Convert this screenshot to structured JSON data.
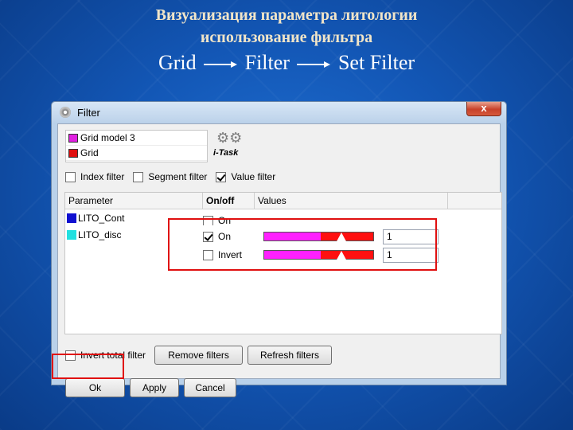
{
  "slide": {
    "title_line1": "Визуализация параметра литологии",
    "title_line2": "использование фильтра",
    "path": [
      "Grid",
      "Filter",
      "Set Filter"
    ]
  },
  "window": {
    "title": "Filter",
    "close_label": "x",
    "grid_list": [
      {
        "label": "Grid model 3",
        "color": "#e020e0"
      },
      {
        "label": "Grid",
        "color": "#e01010"
      }
    ],
    "itask_label": "i-Task",
    "filters": [
      {
        "label": "Index filter",
        "checked": false
      },
      {
        "label": "Segment filter",
        "checked": false
      },
      {
        "label": "Value filter",
        "checked": true
      }
    ],
    "table": {
      "headers": [
        "Parameter",
        "On/off",
        "Values"
      ],
      "parameters": [
        {
          "name": "LITO_Cont",
          "color": "#1010d0"
        },
        {
          "name": "LITO_disc",
          "color": "#20e0e0"
        }
      ],
      "rows": [
        {
          "label": "On",
          "checked": false
        },
        {
          "label": "On",
          "checked": true,
          "value": "1"
        },
        {
          "label": "Invert",
          "checked": false,
          "value": "1"
        }
      ]
    },
    "invert_total_filter": {
      "label": "Invert total filter",
      "checked": false
    },
    "remove_filters_label": "Remove filters",
    "refresh_filters_label": "Refresh filters",
    "ok_label": "Ok",
    "apply_label": "Apply",
    "cancel_label": "Cancel"
  },
  "colors": {
    "slider_left": "#ff20ff",
    "slider_right": "#ff1010",
    "highlight": "#e01010"
  }
}
